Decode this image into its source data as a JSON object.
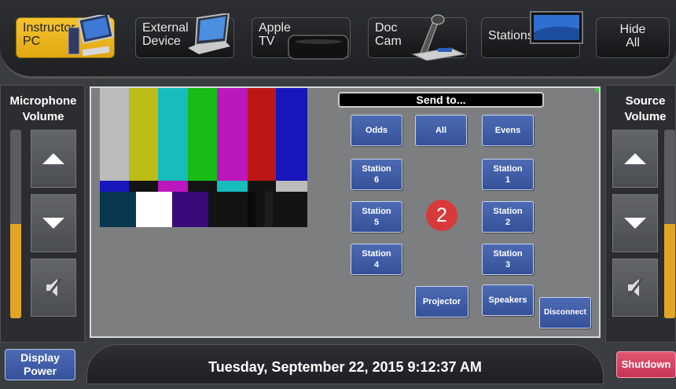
{
  "sources": [
    {
      "label": "Instructor\nPC",
      "active": true,
      "icon": "computer-icon"
    },
    {
      "label": "External\nDevice",
      "active": false,
      "icon": "laptop-icon"
    },
    {
      "label": "Apple\nTV",
      "active": false,
      "icon": "apple-tv-icon"
    },
    {
      "label": "Doc\nCam",
      "active": false,
      "icon": "document-camera-icon"
    },
    {
      "label": "Stations",
      "active": false,
      "icon": "monitor-icon"
    },
    {
      "label": "Hide\nAll",
      "active": false,
      "icon": ""
    }
  ],
  "microphone": {
    "title": "Microphone\nVolume",
    "level": 0.5
  },
  "source_volume": {
    "title": "Source\nVolume",
    "level": 0.5
  },
  "send_to": {
    "title": "Send to...",
    "buttons": {
      "odds": "Odds",
      "all": "All",
      "evens": "Evens",
      "station6": "Station\n6",
      "station1": "Station\n1",
      "station5": "Station\n5",
      "station2": "Station\n2",
      "station4": "Station\n4",
      "station3": "Station\n3",
      "projector": "Projector",
      "speakers": "Speakers",
      "disconnect": "Disconnect"
    },
    "badge": "2"
  },
  "datetime": "Tuesday, September 22, 2015 9:12:37 AM",
  "display_power": "Display\nPower",
  "shutdown": "Shutdown",
  "colors": {
    "active_source": "#f5c430",
    "blue_button": "#3f5ea8",
    "red_button": "#d03a5b",
    "level": "#e0a526",
    "badge": "#d83a3a"
  }
}
